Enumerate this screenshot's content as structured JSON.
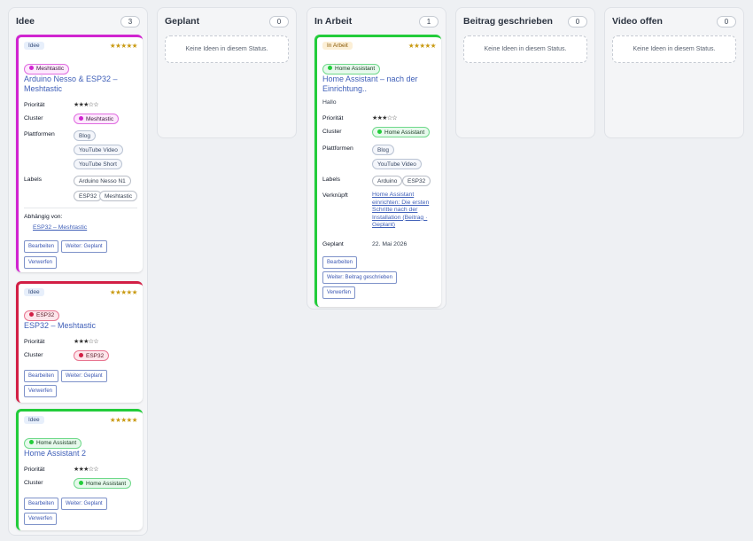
{
  "columns": [
    {
      "title": "Idee",
      "count": "3"
    },
    {
      "title": "Geplant",
      "count": "0",
      "empty": "Keine Ideen in diesem Status."
    },
    {
      "title": "In Arbeit",
      "count": "1"
    },
    {
      "title": "Beitrag geschrieben",
      "count": "0",
      "empty": "Keine Ideen in diesem Status."
    },
    {
      "title": "Video offen",
      "count": "0",
      "empty": "Keine Ideen in diesem Status."
    }
  ],
  "labels": {
    "priority": "Priorität",
    "cluster": "Cluster",
    "platforms": "Plattformen",
    "labels": "Labels",
    "depends": "Abhängig von:",
    "linked": "Verknüpft",
    "planned": "Geplant"
  },
  "cards": {
    "c1": {
      "status": "Idee",
      "stars": "★★★★★",
      "cluster": "Meshtastic",
      "title": "Arduino Nesso & ESP32 – Meshtastic",
      "priority": "★★★☆☆",
      "platforms": [
        "Blog",
        "YouTube Video",
        "YouTube Short"
      ],
      "labels": [
        "Arduino Nesso N1",
        "ESP32",
        "Meshtastic"
      ],
      "depends_link": "ESP32 – Meshtastic",
      "btn_edit": "Bearbeiten",
      "btn_next": "Weiter: Geplant",
      "btn_discard": "Verwerfen",
      "color": "#d024d0"
    },
    "c2": {
      "status": "Idee",
      "stars": "★★★★★",
      "cluster": "ESP32",
      "title": "ESP32 – Meshtastic",
      "priority": "★★★☆☆",
      "btn_edit": "Bearbeiten",
      "btn_next": "Weiter: Geplant",
      "btn_discard": "Verwerfen",
      "color": "#d21f45"
    },
    "c3": {
      "status": "Idee",
      "stars": "★★★★★",
      "cluster": "Home Assistant",
      "title": "Home Assistant 2",
      "priority": "★★★☆☆",
      "btn_edit": "Bearbeiten",
      "btn_next": "Weiter: Geplant",
      "btn_discard": "Verwerfen",
      "color": "#22cc3a"
    },
    "c4": {
      "status": "In Arbeit",
      "stars": "★★★★★",
      "cluster": "Home Assistant",
      "title": "Home Assistant – nach der Einrichtung..",
      "desc": "Hallo",
      "priority": "★★★☆☆",
      "platforms": [
        "Blog",
        "YouTube Video"
      ],
      "labels": [
        "Arduino",
        "ESP32"
      ],
      "linked": "Home Assistant einrichten: Die ersten Schritte nach der Installation (Beitrag · Geplant)",
      "planned_date": "22. Mai 2026",
      "btn_edit": "Bearbeiten",
      "btn_next": "Weiter: Beitrag geschrieben",
      "btn_discard": "Verwerfen",
      "color": "#22cc3a"
    }
  },
  "colors": {
    "meshtastic": "#d024d0",
    "esp32": "#d21f45",
    "home_assistant": "#22cc3a"
  }
}
